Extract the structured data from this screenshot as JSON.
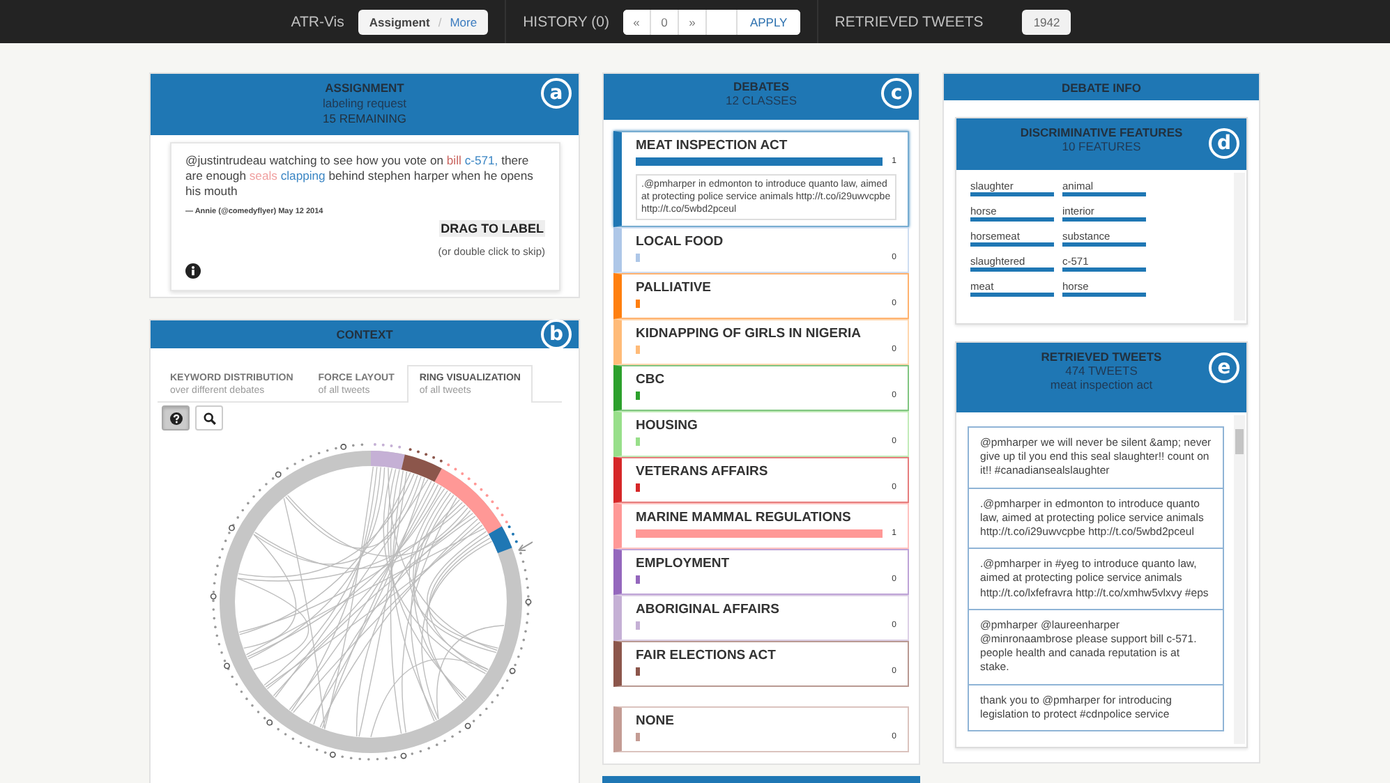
{
  "top_bar": {
    "app_name": "ATR-Vis",
    "mode_buttons": [
      {
        "label": "Assigment",
        "selected": true
      },
      {
        "label": "More",
        "selected": false
      }
    ],
    "mode_separator": "/",
    "history_label": "HISTORY (0)",
    "pager": {
      "prev": "«",
      "page": "0",
      "next": "»",
      "apply": "APPLY"
    },
    "retrieved_label": "RETRIEVED TWEETS",
    "retrieved_count": "1942"
  },
  "assignment": {
    "title": "ASSIGNMENT",
    "subtitle": "labeling request",
    "remaining": "15 REMAINING",
    "badge": "a",
    "tweet": [
      {
        "text": "@justintrudeau watching to see how you vote on "
      },
      {
        "text": "bill ",
        "color": "#c9645e"
      },
      {
        "text": "c-571,",
        "color": "#3b86c4"
      },
      {
        "text": " there are enough "
      },
      {
        "text": "seals ",
        "color": "#f0a0a0"
      },
      {
        "text": "clapping",
        "color": "#3b86c4"
      },
      {
        "text": " behind stephen harper when he opens his mouth"
      }
    ],
    "byline": "— Annie (@comedyflyer) May 12 2014",
    "drag_label": "DRAG TO LABEL",
    "skip_hint": "(or double click to skip)"
  },
  "context": {
    "title": "CONTEXT",
    "badge": "b",
    "tabs": [
      {
        "title": "KEYWORD DISTRIBUTION",
        "subtitle": "over different debates",
        "selected": false
      },
      {
        "title": "FORCE LAYOUT",
        "subtitle": "of all tweets",
        "selected": false
      },
      {
        "title": "RING VISUALIZATION",
        "subtitle": "of all tweets",
        "selected": true
      }
    ],
    "tools": [
      {
        "kind": "help",
        "selected": true
      },
      {
        "kind": "search",
        "selected": false
      }
    ]
  },
  "debates": {
    "title": "DEBATES",
    "subtitle": "12 CLASSES",
    "badge": "c",
    "classes": [
      {
        "name": "MEAT INSPECTION ACT",
        "color": "#1f77b4",
        "count": "1",
        "selected": true,
        "tweet": ".@pmharper in edmonton to introduce quanto law, aimed at protecting police service animals http://t.co/i29uwvcpbe http://t.co/5wbd2pceul"
      },
      {
        "name": "LOCAL FOOD",
        "color": "#aec7e8",
        "count": "0",
        "selected": false
      },
      {
        "name": "PALLIATIVE",
        "color": "#ff7f0e",
        "count": "0",
        "selected": false
      },
      {
        "name": "KIDNAPPING OF GIRLS IN NIGERIA",
        "color": "#ffbb78",
        "count": "0",
        "selected": false
      },
      {
        "name": "CBC",
        "color": "#2ca02c",
        "count": "0",
        "selected": false
      },
      {
        "name": "HOUSING",
        "color": "#98df8a",
        "count": "0",
        "selected": false
      },
      {
        "name": "VETERANS AFFAIRS",
        "color": "#d62728",
        "count": "0",
        "selected": false
      },
      {
        "name": "MARINE MAMMAL REGULATIONS",
        "color": "#ff9896",
        "count": "1",
        "selected": false
      },
      {
        "name": "EMPLOYMENT",
        "color": "#9467bd",
        "count": "0",
        "selected": false
      },
      {
        "name": "ABORIGINAL AFFAIRS",
        "color": "#c5b0d5",
        "count": "0",
        "selected": false
      },
      {
        "name": "FAIR ELECTIONS ACT",
        "color": "#8c564b",
        "count": "0",
        "selected": false
      }
    ],
    "none": {
      "name": "NONE",
      "color": "#c49c94",
      "count": "0",
      "selected": false
    }
  },
  "debate_info": {
    "title": "DEBATE INFO",
    "features": {
      "title": "DISCRIMINATIVE FEATURES",
      "subtitle": "10 FEATURES",
      "badge": "d",
      "items": [
        "slaughter",
        "animal",
        "horse",
        "interior",
        "horsemeat",
        "substance",
        "slaughtered",
        "c-571",
        "meat",
        "horse"
      ]
    },
    "tweets": {
      "title": "RETRIEVED TWEETS",
      "subtitle": "474 TWEETS",
      "topic": "meat inspection act",
      "badge": "e",
      "items": [
        "@pmharper we will never be silent &amp; never give up til you end this seal slaughter!! count on it!! #canadiansealslaughter",
        ".@pmharper in edmonton to introduce quanto law, aimed at protecting police service animals http://t.co/i29uwvcpbe http://t.co/5wbd2pceul",
        ".@pmharper in #yeg to introduce quanto law, aimed at protecting police service animals http://t.co/lxfefravra http://t.co/xmhw5vlxvy #eps",
        "@pmharper @laureenharper @minronaambrose please support bill c-571. people health and canada reputation is at stake.",
        "thank you to @pmharper for introducing legislation to protect #cdnpolice service"
      ]
    }
  }
}
